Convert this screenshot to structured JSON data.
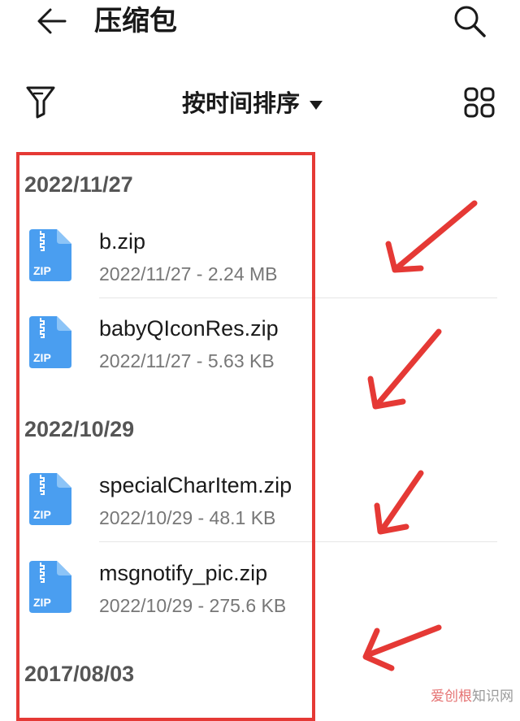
{
  "header": {
    "title": "压缩包",
    "back_icon": "arrow-left-icon",
    "search_icon": "search-icon"
  },
  "toolbar": {
    "filter_icon": "filter-icon",
    "sort_label": "按时间排序",
    "sort_caret_icon": "caret-down-icon",
    "grid_icon": "grid-view-icon"
  },
  "groups": [
    {
      "date": "2022/11/27",
      "files": [
        {
          "name": "b.zip",
          "meta": "2022/11/27 - 2.24 MB",
          "icon_label": "ZIP"
        },
        {
          "name": "babyQIconRes.zip",
          "meta": "2022/11/27 - 5.63 KB",
          "icon_label": "ZIP"
        }
      ]
    },
    {
      "date": "2022/10/29",
      "files": [
        {
          "name": "specialCharItem.zip",
          "meta": "2022/10/29 - 48.1 KB",
          "icon_label": "ZIP"
        },
        {
          "name": "msgnotify_pic.zip",
          "meta": "2022/10/29 - 275.6 KB",
          "icon_label": "ZIP"
        }
      ]
    },
    {
      "date": "2017/08/03",
      "files": []
    }
  ],
  "annotations": {
    "highlight_color": "#e53935",
    "arrow_color": "#e53935",
    "arrow_count": 4
  },
  "watermark": {
    "accent": "爱创根",
    "rest": "知识网"
  },
  "colors": {
    "zip_icon": "#4a9ef0",
    "zip_icon_fold": "#8cc4f7",
    "text_primary": "#1a1a1a",
    "text_secondary": "#777777"
  }
}
